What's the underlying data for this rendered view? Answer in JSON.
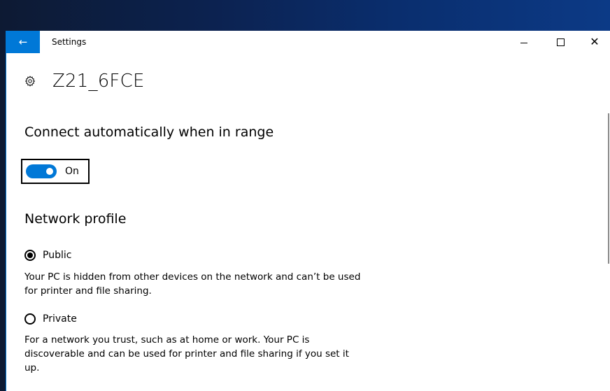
{
  "window": {
    "title": "Settings"
  },
  "header": {
    "network_name": "Z21_6FCE"
  },
  "auto_connect": {
    "heading": "Connect automatically when in range",
    "toggle_state": "On",
    "enabled": true
  },
  "network_profile": {
    "heading": "Network profile",
    "options": [
      {
        "label": "Public",
        "selected": true,
        "description": "Your PC is hidden from other devices on the network and can’t be used for printer and file sharing."
      },
      {
        "label": "Private",
        "selected": false,
        "description": "For a network you trust, such as at home or work. Your PC is discoverable and can be used for printer and file sharing if you set it up."
      }
    ]
  },
  "colors": {
    "accent": "#0078d7",
    "background": "#ffffff",
    "text": "#000000"
  },
  "icons": {
    "back": "back-arrow-icon",
    "settings": "gear-icon"
  }
}
